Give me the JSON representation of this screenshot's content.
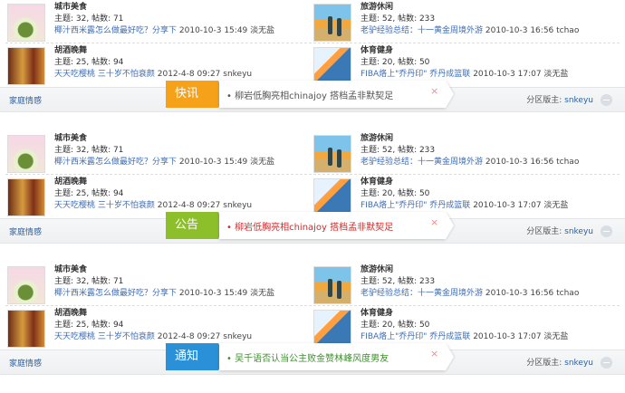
{
  "blocks": [
    {
      "badge_label": "快讯",
      "badge_color": "#f5a21a",
      "notice_text": "• 柳岩低胸亮相chinajoy 搭档孟非默契足",
      "notice_color": "#555555",
      "footer_left": "家庭情感",
      "moderator_label": "分区版主:",
      "moderator_name": "snkeyu",
      "forums": [
        {
          "title": "城市美食",
          "counts": "主题: 32, 帖数: 71",
          "last_post": "椰汁西米露怎么做最好吃？分享下",
          "time_user": "2010-10-3 15:49 淡无盐",
          "icon": "food"
        },
        {
          "title": "旅游休闲",
          "counts": "主题: 52, 帖数: 233",
          "last_post": "老驴经验总结：十一黄金周境外游",
          "time_user": "2010-10-3 16:56 tchao",
          "icon": "beach"
        },
        {
          "title": "胡酒晚舞",
          "counts": "主题: 25, 帖数: 94",
          "last_post": "天天吃樱桃 三十岁不怕衰颜",
          "time_user": "2012-4-8 09:27 snkeyu",
          "icon": "bar"
        },
        {
          "title": "体育健身",
          "counts": "主题: 20, 帖数: 50",
          "last_post": "FIBA烙上\"乔丹印\" 乔丹成篮联",
          "time_user": "2010-10-3 17:07 淡无盐",
          "icon": "sport"
        }
      ]
    },
    {
      "badge_label": "公告",
      "badge_color": "#8cbf2a",
      "notice_text": "• 柳岩低胸亮相chinajoy 搭档孟非默契足",
      "notice_color": "#d22b2b",
      "footer_left": "家庭情感",
      "moderator_label": "分区版主:",
      "moderator_name": "snkeyu",
      "forums": [
        {
          "title": "城市美食",
          "counts": "主题: 32, 帖数: 71",
          "last_post": "椰汁西米露怎么做最好吃？分享下",
          "time_user": "2010-10-3 15:49 淡无盐",
          "icon": "food"
        },
        {
          "title": "旅游休闲",
          "counts": "主题: 52, 帖数: 233",
          "last_post": "老驴经验总结：十一黄金周境外游",
          "time_user": "2010-10-3 16:56 tchao",
          "icon": "beach"
        },
        {
          "title": "胡酒晚舞",
          "counts": "主题: 25, 帖数: 94",
          "last_post": "天天吃樱桃 三十岁不怕衰颜",
          "time_user": "2012-4-8 09:27 snkeyu",
          "icon": "bar"
        },
        {
          "title": "体育健身",
          "counts": "主题: 20, 帖数: 50",
          "last_post": "FIBA烙上\"乔丹印\" 乔丹成篮联",
          "time_user": "2010-10-3 17:07 淡无盐",
          "icon": "sport"
        }
      ]
    },
    {
      "badge_label": "通知",
      "badge_color": "#2a91d9",
      "notice_text": "• 吴千语否认当公主败金赞林峰风度男友",
      "notice_color": "#3f8f2f",
      "footer_left": "家庭情感",
      "moderator_label": "分区版主:",
      "moderator_name": "snkeyu",
      "forums": [
        {
          "title": "城市美食",
          "counts": "主题: 32, 帖数: 71",
          "last_post": "椰汁西米露怎么做最好吃？分享下",
          "time_user": "2010-10-3 15:49 淡无盐",
          "icon": "food"
        },
        {
          "title": "旅游休闲",
          "counts": "主题: 52, 帖数: 233",
          "last_post": "老驴经验总结：十一黄金周境外游",
          "time_user": "2010-10-3 16:56 tchao",
          "icon": "beach"
        },
        {
          "title": "胡酒晚舞",
          "counts": "主题: 25, 帖数: 94",
          "last_post": "天天吃樱桃 三十岁不怕衰颜",
          "time_user": "2012-4-8 09:27 snkeyu",
          "icon": "bar"
        },
        {
          "title": "体育健身",
          "counts": "主题: 20, 帖数: 50",
          "last_post": "FIBA烙上\"乔丹印\" 乔丹成篮联",
          "time_user": "2010-10-3 17:07 淡无盐",
          "icon": "sport"
        }
      ]
    }
  ]
}
